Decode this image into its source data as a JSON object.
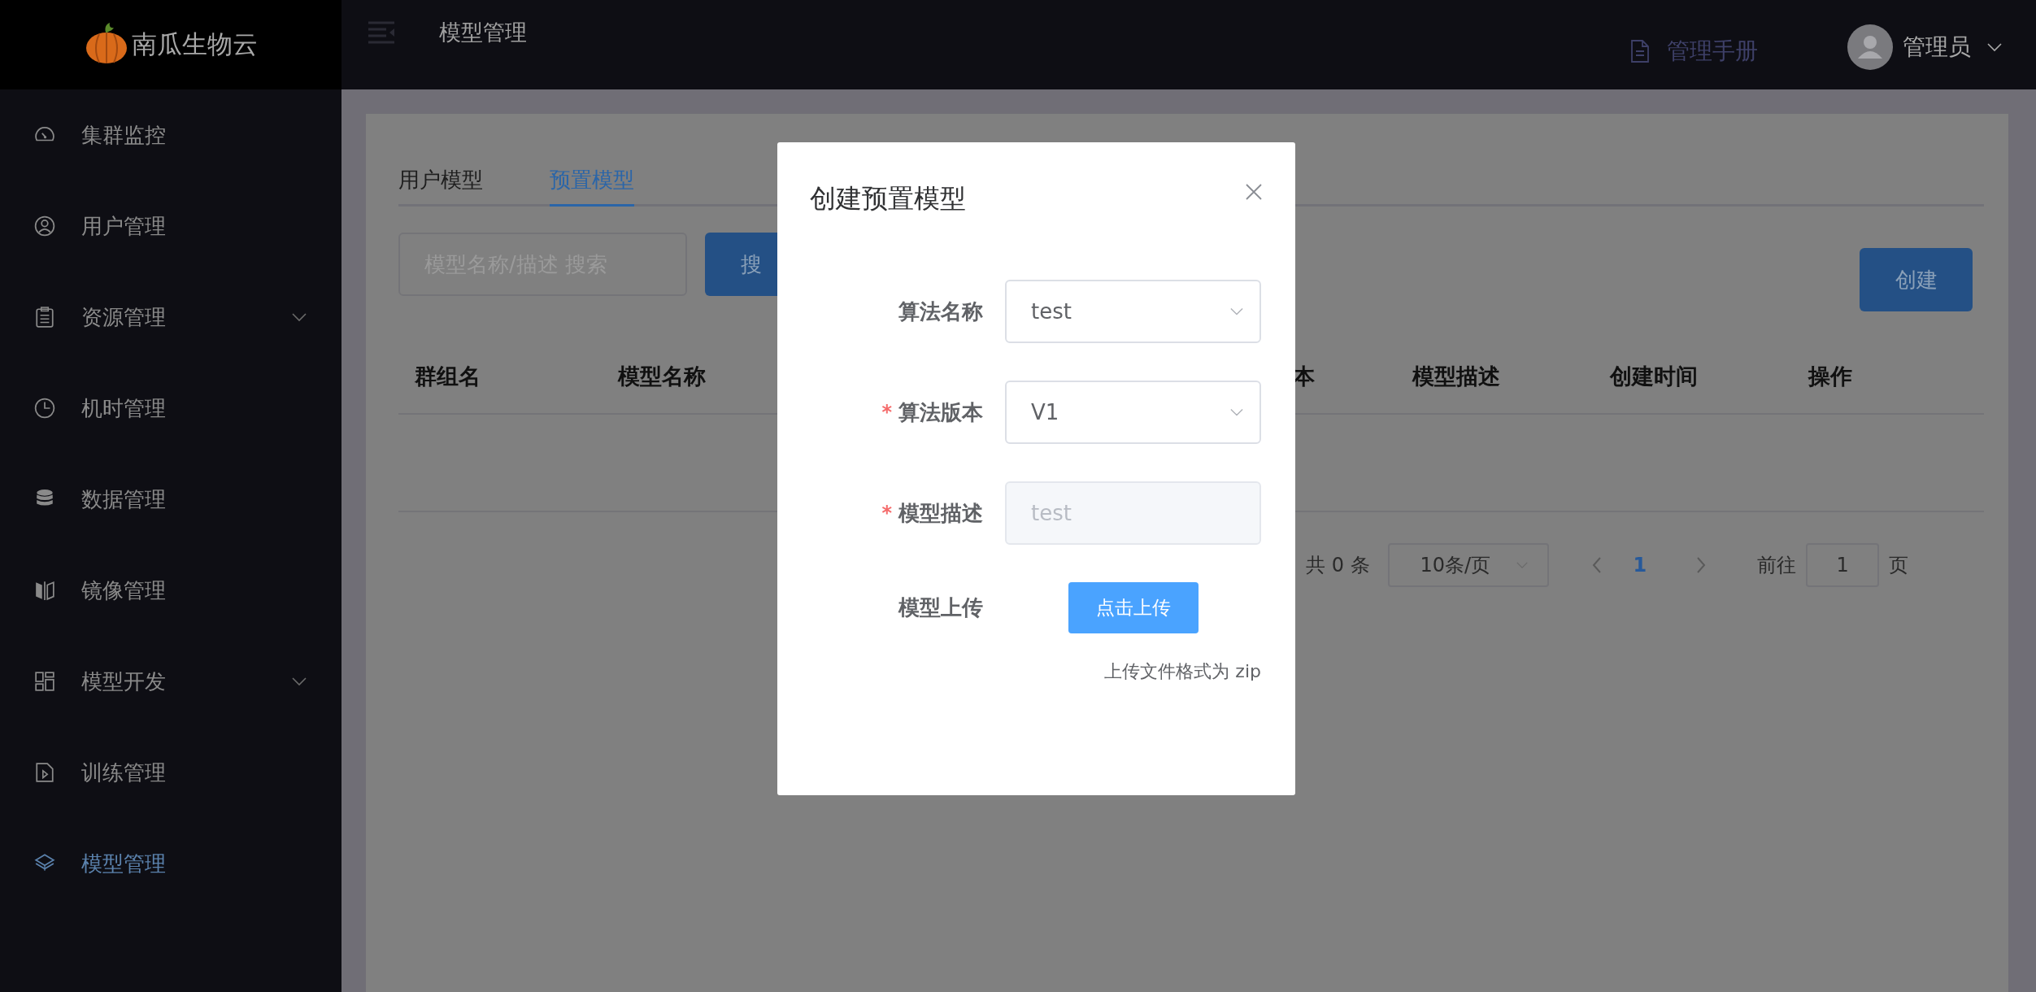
{
  "brand": {
    "name": "南瓜生物云"
  },
  "sidebar": {
    "items": [
      {
        "label": "集群监控",
        "selected": false,
        "expandable": false
      },
      {
        "label": "用户管理",
        "selected": false,
        "expandable": false
      },
      {
        "label": "资源管理",
        "selected": false,
        "expandable": true
      },
      {
        "label": "机时管理",
        "selected": false,
        "expandable": false
      },
      {
        "label": "数据管理",
        "selected": false,
        "expandable": false
      },
      {
        "label": "镜像管理",
        "selected": false,
        "expandable": false
      },
      {
        "label": "模型开发",
        "selected": false,
        "expandable": true
      },
      {
        "label": "训练管理",
        "selected": false,
        "expandable": false
      },
      {
        "label": "模型管理",
        "selected": true,
        "expandable": false
      }
    ]
  },
  "header": {
    "title": "模型管理",
    "manual_link": "管理手册",
    "user": "管理员"
  },
  "tabs": [
    {
      "label": "用户模型",
      "selected": false
    },
    {
      "label": "预置模型",
      "selected": true
    }
  ],
  "search": {
    "placeholder": "模型名称/描述 搜索",
    "button": "搜"
  },
  "create_button": "创建",
  "table": {
    "columns": [
      "群组名",
      "模型名称",
      "本",
      "模型描述",
      "创建时间",
      "操作"
    ]
  },
  "pagination": {
    "total": "共 0 条",
    "page_size": "10条/页",
    "pages": [
      {
        "label": "1",
        "selected": true
      }
    ],
    "jump_label": "前往",
    "jump_value": "1",
    "page_suffix": "页"
  },
  "dialog": {
    "title": "创建预置模型",
    "fields": [
      {
        "kind": "select",
        "label": "算法名称",
        "value": "test",
        "disabled": false
      },
      {
        "kind": "select",
        "label": "算法版本",
        "required_mark": "*",
        "value": "V1",
        "disabled": false
      },
      {
        "kind": "input",
        "label": "模型描述",
        "required_mark": "*",
        "value": "test",
        "disabled": true
      },
      {
        "kind": "upload",
        "label": "模型上传",
        "button": "点击上传",
        "hint": "上传文件格式为 zip",
        "disabled": false
      }
    ]
  }
}
